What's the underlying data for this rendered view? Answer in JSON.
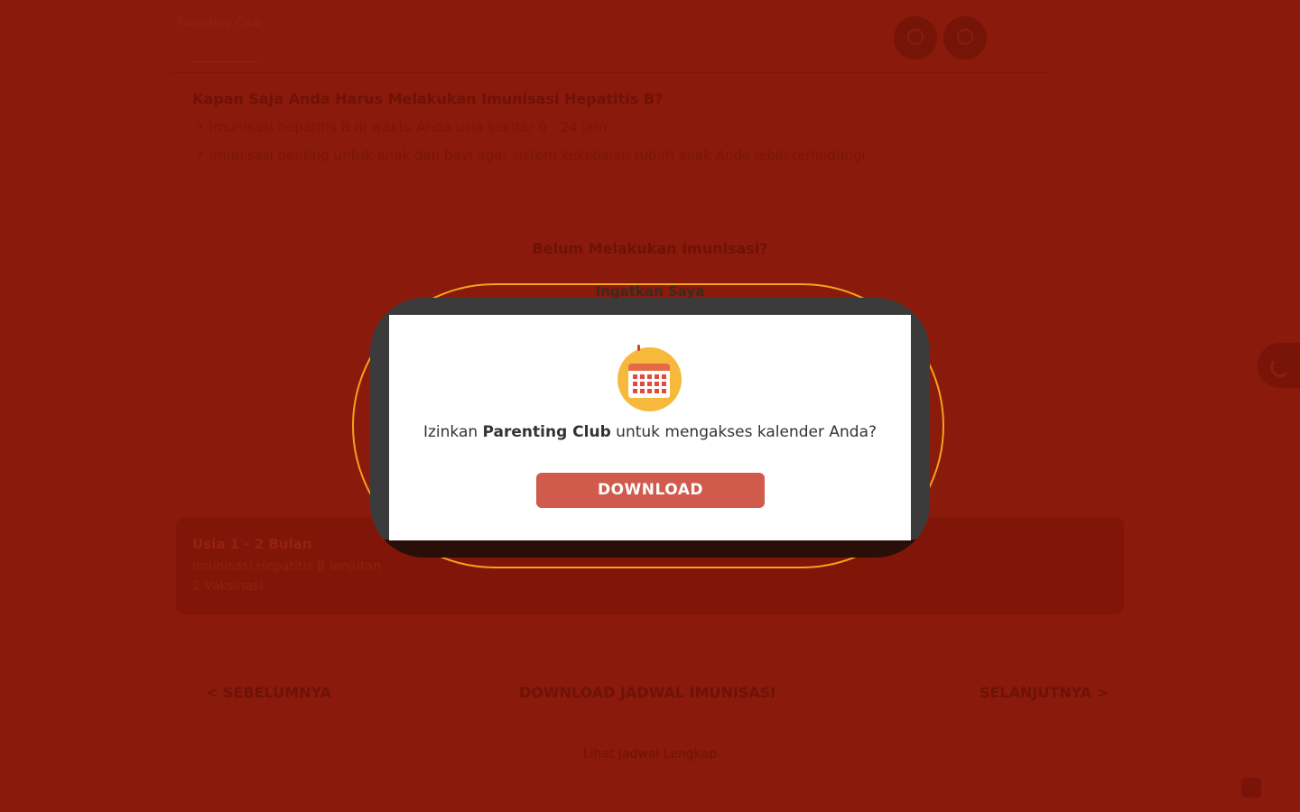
{
  "background": {
    "logo_text": "Parenting Club",
    "question": "Kapan Saja Anda Harus Melakukan Imunisasi Hepatitis B?",
    "bullets": [
      "Imunisasi hepatitis B di waktu Anda usia sekitar 0 - 24 jam",
      "Imunisasi penting untuk anak dan bayi agar sistem kekebalan tubuh anak Anda lebih terlindungi"
    ],
    "center_question": "Belum Melakukan Imunisasi?",
    "center_link": "Ingatkan Saya",
    "card": {
      "title": "Usia 1 - 2 Bulan",
      "lines": [
        "Imunisasi Hepatitis B lanjutan",
        "2 Vaksinasi"
      ]
    },
    "nav": {
      "prev": "< SEBELUMNYA",
      "middle": "DOWNLOAD JADWAL IMUNISASI",
      "next": "SELANJUTNYA >"
    },
    "footer": "Lihat Jadwal Lengkap"
  },
  "dialog": {
    "text_prefix": "Izinkan ",
    "app_name": "Parenting Club",
    "text_suffix": " untuk mengakses kalender Anda?",
    "button_label": "DOWNLOAD",
    "icon": "calendar-icon"
  },
  "colors": {
    "backdrop": "#8a1a0b",
    "ring": "#f2a41b",
    "button": "#d05a4b",
    "icon_bg": "#f6b93b"
  }
}
